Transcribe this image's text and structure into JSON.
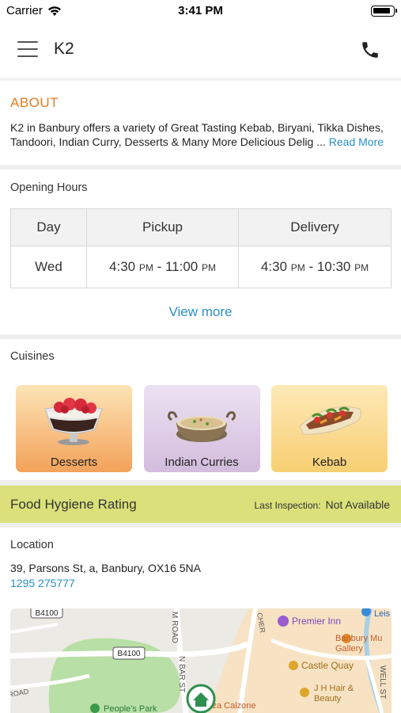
{
  "status_bar": {
    "carrier": "Carrier",
    "time": "3:41 PM"
  },
  "header": {
    "title": "K2",
    "menu_icon": "hamburger-menu-icon",
    "call_icon": "phone-icon"
  },
  "about": {
    "title": "ABOUT",
    "text": "K2 in Banbury offers a variety of Great Tasting Kebab, Biryani, Tikka Dishes, Tandoori, Indian Curry, Desserts & Many More Delicious Delig ...",
    "read_more": "Read More"
  },
  "opening_hours": {
    "title": "Opening Hours",
    "columns": [
      "Day",
      "Pickup",
      "Delivery"
    ],
    "row": {
      "day": "Wed",
      "pickup_start": "4:30",
      "pickup_end": "11:00",
      "delivery_start": "4:30",
      "delivery_end": "10:30",
      "pm": "PM",
      "dash": " - "
    },
    "view_more": "View more"
  },
  "cuisines": {
    "title": "Cuisines",
    "items": [
      {
        "label": "Desserts"
      },
      {
        "label": "Indian Curries"
      },
      {
        "label": "Kebab"
      }
    ]
  },
  "hygiene": {
    "title": "Food Hygiene Rating",
    "inspection_label": "Last Inspection:",
    "inspection_value": "Not Available"
  },
  "location": {
    "title": "Location",
    "address": "39, Parsons St, a, Banbury, OX16 5NA",
    "phone": "1295 275777"
  },
  "map": {
    "labels": {
      "road1": "B4100",
      "road2": "B4100",
      "premier_inn": "Premier Inn",
      "banbury_museum": "Banbury Mu",
      "gallery": "Gallery",
      "castle_quay": "Castle Quay",
      "hair": "J H Hair &",
      "beauty": "Beauty",
      "peoples_park": "People's Park",
      "pizza": "zza Calzone",
      "m_road": "M ROAD",
      "n_bar": "N BAR ST",
      "cher": "CHER",
      "well_st": "WELL ST",
      "road_left": "ROAD",
      "leis": "Leis"
    }
  }
}
